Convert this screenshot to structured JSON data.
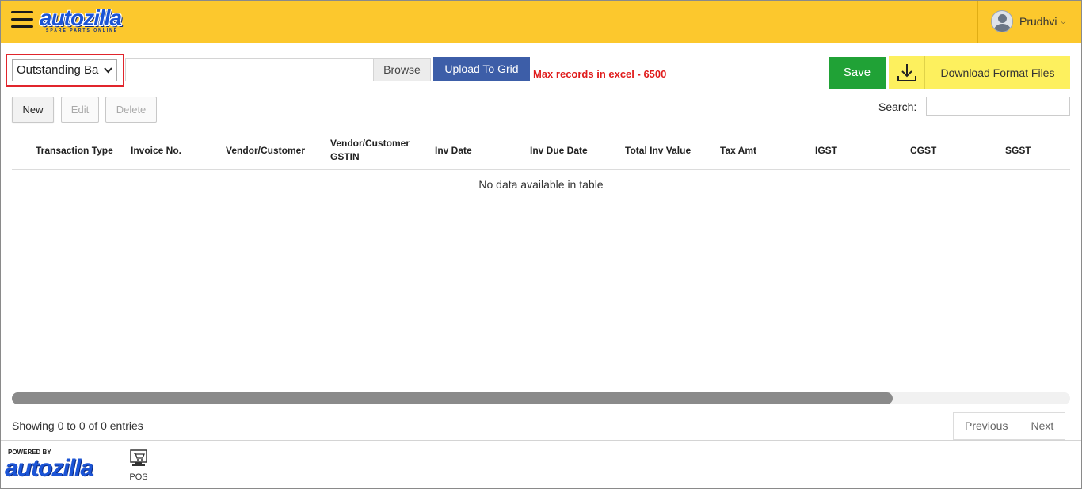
{
  "header": {
    "logo": "autozilla",
    "logo_tagline": "SPARE PARTS ONLINE",
    "user_name": "Prudhvi",
    "user_chevron": "⌵"
  },
  "upload": {
    "type_select": "Outstanding Ba",
    "browse_label": "Browse",
    "upload_label": "Upload To Grid",
    "max_records_text": "Max records in excel - 6500",
    "save_label": "Save",
    "download_label": "Download Format Files"
  },
  "actions": {
    "new_label": "New",
    "edit_label": "Edit",
    "delete_label": "Delete",
    "search_label": "Search:"
  },
  "table": {
    "columns": [
      "Transaction Type",
      "Invoice No.",
      "Vendor/Customer",
      "Vendor/Customer GSTIN",
      "Inv Date",
      "Inv Due Date",
      "Total Inv Value",
      "Tax Amt",
      "IGST",
      "CGST",
      "SGST"
    ],
    "empty_text": "No data available in table"
  },
  "footer": {
    "showing_text": "Showing 0 to 0 of 0 entries",
    "previous_label": "Previous",
    "next_label": "Next",
    "powered_by": "POWERED BY",
    "bottom_logo": "autozilla",
    "pos_label": "POS"
  },
  "colors": {
    "header_bg": "#fcc82d",
    "upload_btn": "#3d5ea8",
    "save_btn": "#20a236",
    "download_btn": "#fdf05e",
    "warning_text": "#e01c1c",
    "highlight_border": "#e1252c"
  }
}
